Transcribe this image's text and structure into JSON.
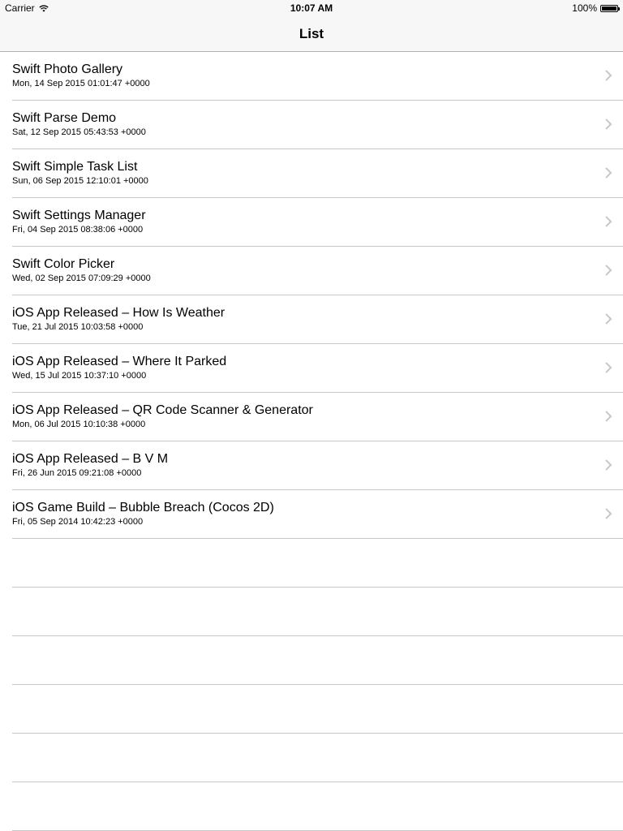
{
  "status_bar": {
    "carrier": "Carrier",
    "time": "10:07 AM",
    "battery_percent": "100%",
    "battery_level": 1.0,
    "wifi_icon": "wifi-icon",
    "battery_icon": "battery-icon"
  },
  "nav": {
    "title": "List"
  },
  "list": {
    "chevron_icon": "chevron-right-icon",
    "chevron_color": "#c7c7cc",
    "items": [
      {
        "title": "Swift Photo Gallery",
        "date": "Mon, 14 Sep 2015 01:01:47 +0000"
      },
      {
        "title": "Swift Parse Demo",
        "date": "Sat, 12 Sep 2015 05:43:53 +0000"
      },
      {
        "title": "Swift Simple Task List",
        "date": "Sun, 06 Sep 2015 12:10:01 +0000"
      },
      {
        "title": "Swift Settings Manager",
        "date": "Fri, 04 Sep 2015 08:38:06 +0000"
      },
      {
        "title": "Swift Color Picker",
        "date": "Wed, 02 Sep 2015 07:09:29 +0000"
      },
      {
        "title": "iOS App Released – How Is Weather",
        "date": "Tue, 21 Jul 2015 10:03:58 +0000"
      },
      {
        "title": "iOS App Released – Where It Parked",
        "date": "Wed, 15 Jul 2015 10:37:10 +0000"
      },
      {
        "title": "iOS App Released – QR Code Scanner & Generator",
        "date": "Mon, 06 Jul 2015 10:10:38 +0000"
      },
      {
        "title": "iOS App Released – B V M",
        "date": "Fri, 26 Jun 2015 09:21:08 +0000"
      },
      {
        "title": "iOS Game Build – Bubble Breach (Cocos 2D)",
        "date": "Fri, 05 Sep 2014 10:42:23 +0000"
      }
    ]
  }
}
